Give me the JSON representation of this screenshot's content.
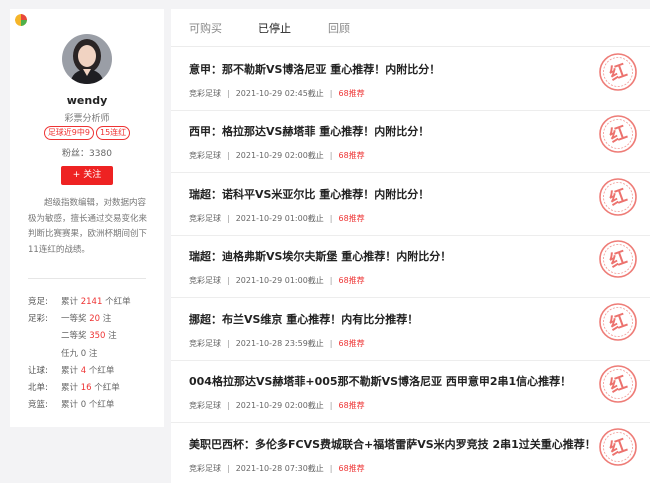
{
  "profile": {
    "name": "wendy",
    "role": "彩票分析师",
    "tags": [
      "足球近9中9",
      "15连红"
    ],
    "fans_label": "粉丝：",
    "fans_count": "3380",
    "follow_label": "+ 关注",
    "bio": "超级指数编辑，对数据内容极为敏感，擅长通过交易变化来判断比赛赛果，欧洲杯期间创下11连红的战绩。",
    "stats": [
      {
        "category": "竞足:",
        "prefix": "累计",
        "value": "2141",
        "suffix": "个红单"
      },
      {
        "category": "足彩:",
        "prefix": "一等奖",
        "value": "20",
        "suffix": "注"
      },
      {
        "category": "",
        "prefix": "二等奖",
        "value": "350",
        "suffix": "注"
      },
      {
        "category": "",
        "prefix": "任九",
        "value": "0",
        "suffix": "注"
      },
      {
        "category": "让球:",
        "prefix": "累计",
        "value": "4",
        "suffix": "个红单"
      },
      {
        "category": "北单:",
        "prefix": "累计",
        "value": "16",
        "suffix": "个红单"
      },
      {
        "category": "竞篮:",
        "prefix": "累计",
        "value": "0",
        "suffix": "个红单"
      }
    ]
  },
  "tabs": [
    "可购买",
    "已停止",
    "回顾"
  ],
  "active_tab": "已停止",
  "stamp_text": "红",
  "articles": [
    {
      "title": "意甲：那不勒斯VS博洛尼亚 重心推荐！内附比分！",
      "type": "竞彩足球",
      "time": "2021-10-29 02:45截止",
      "views": "68推荐"
    },
    {
      "title": "西甲：格拉那达VS赫塔菲 重心推荐！内附比分！",
      "type": "竞彩足球",
      "time": "2021-10-29 02:00截止",
      "views": "68推荐"
    },
    {
      "title": "瑞超：诺科平VS米亚尔比 重心推荐！内附比分！",
      "type": "竞彩足球",
      "time": "2021-10-29 01:00截止",
      "views": "68推荐"
    },
    {
      "title": "瑞超：迪格弗斯VS埃尔夫斯堡 重心推荐！内附比分！",
      "type": "竞彩足球",
      "time": "2021-10-29 01:00截止",
      "views": "68推荐"
    },
    {
      "title": "挪超：布兰VS维京 重心推荐！内有比分推荐！",
      "type": "竞彩足球",
      "time": "2021-10-28 23:59截止",
      "views": "68推荐"
    },
    {
      "title": "004格拉那达VS赫塔菲+005那不勒斯VS博洛尼亚 西甲意甲2串1信心推荐！",
      "type": "竞彩足球",
      "time": "2021-10-29 02:00截止",
      "views": "68推荐"
    },
    {
      "title": "美职巴西杯：多伦多FCVS费城联合+福塔雷萨VS米内罗竞技 2串1过关重心推荐！",
      "type": "竞彩足球",
      "time": "2021-10-28 07:30截止",
      "views": "68推荐"
    }
  ],
  "colors": {
    "accent": "#ee2222",
    "stamp": "#e8504a"
  }
}
